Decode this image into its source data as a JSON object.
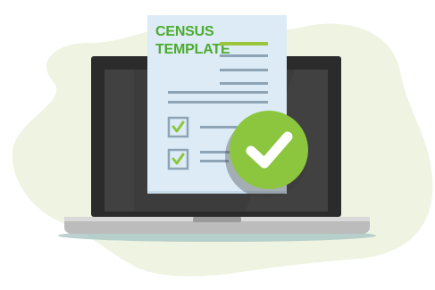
{
  "document": {
    "title_line1": "CENSUS",
    "title_line2": "TEMPLATE",
    "checkboxes": [
      {
        "checked": true
      },
      {
        "checked": true
      }
    ]
  },
  "badge": {
    "icon": "checkmark-icon",
    "color": "#8cc63f"
  },
  "colors": {
    "blob": "#eef3e2",
    "laptop_frame": "#2b2b2b",
    "screen": "#3c3c3c",
    "paper": "#dcebf6",
    "accent_green": "#4dab2f",
    "lines": "#8ea4b5"
  }
}
